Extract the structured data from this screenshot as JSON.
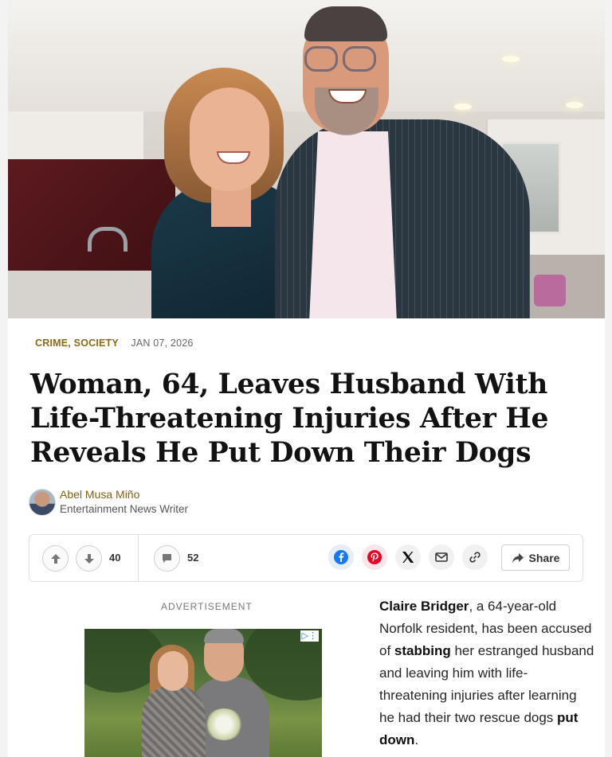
{
  "article": {
    "categories": [
      "CRIME",
      "SOCIETY"
    ],
    "category_separator": ",",
    "date": "JAN 07, 2026",
    "headline": "Woman, 64, Leaves Husband With Life-Threatening Injuries After He Reveals He Put Down Their Dogs",
    "author": {
      "name": "Abel Musa Miño",
      "role": "Entertainment News Writer"
    },
    "body": [
      {
        "text": "Claire Bridger",
        "bold": true
      },
      {
        "text": ", a 64-year-old Norfolk resident, has been accused of ",
        "bold": false
      },
      {
        "text": "stabbing",
        "bold": true
      },
      {
        "text": " her estranged husband and leaving him with life-threatening injuries after learning he had their two rescue dogs ",
        "bold": false
      },
      {
        "text": "put down",
        "bold": true
      },
      {
        "text": ".",
        "bold": false
      }
    ]
  },
  "actions": {
    "upvote_count": "40",
    "comment_count": "52",
    "share_label": "Share",
    "share_icons": [
      "facebook-icon",
      "pinterest-icon",
      "x-icon",
      "email-icon",
      "link-icon"
    ]
  },
  "ad": {
    "label": "ADVERTISEMENT"
  },
  "colors": {
    "category": "#8a6a1c",
    "author": "#7f6218",
    "facebook": "#1877f2",
    "pinterest": "#e60023",
    "headline": "#121212"
  }
}
